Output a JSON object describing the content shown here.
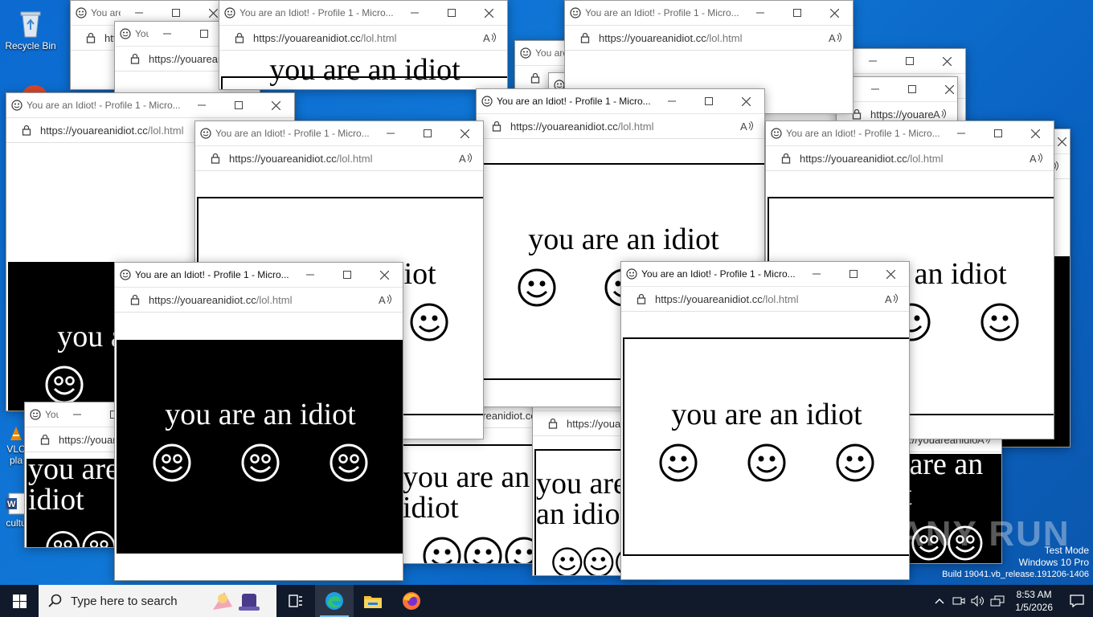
{
  "desktop": {
    "icons": [
      {
        "label": "Recycle Bin",
        "icon": "recycle-bin-icon"
      },
      {
        "label": "VLC\npla",
        "icon": "vlc-icon"
      },
      {
        "label": "cultu",
        "icon": "word-doc-icon"
      }
    ]
  },
  "browser": {
    "title": "You are an Idiot! - Profile 1 - Micro...",
    "url_host": "https://youareanidiot.cc",
    "url_path": "/lol.html",
    "page_text": "you are an idiot"
  },
  "watermark": {
    "line1": "Test Mode",
    "line2": "Windows 10 Pro",
    "line3": "Build 19041.vb_release.191206-1406",
    "brand": "ANY RUN"
  },
  "taskbar": {
    "search_placeholder": "Type here to search",
    "apps": [
      "task-view-icon",
      "edge-icon",
      "file-explorer-icon",
      "firefox-icon"
    ],
    "time": "8:53 AM",
    "date": "1/5/2026"
  },
  "colors": {
    "desktop": "#0c6ad0",
    "taskbar": "#101a2a",
    "accent": "#76b9ed"
  }
}
